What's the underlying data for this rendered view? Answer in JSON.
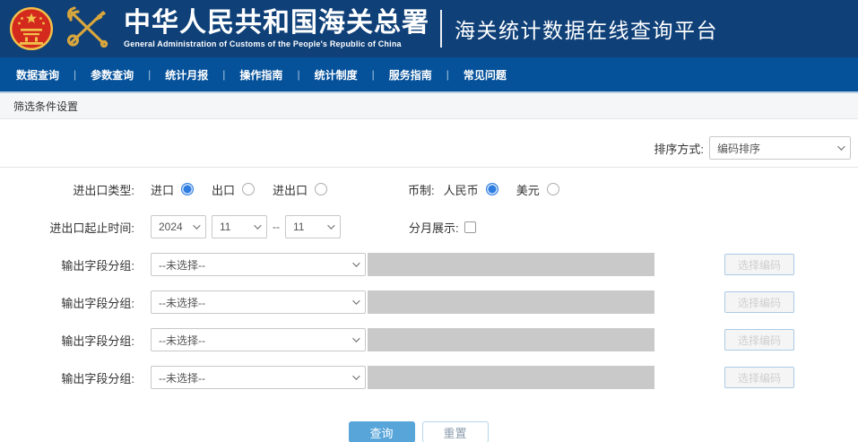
{
  "colors": {
    "header_bg": "#0f4078",
    "nav_bg": "#05529b",
    "query_button": "#58a5da",
    "radio_selected": "#2f7ce0",
    "disabled_input": "#c9c9c9"
  },
  "header": {
    "emblem_icon": "china-national-emblem",
    "key_icon": "customs-key-and-caduceus",
    "org_title": "中华人民共和国海关总署",
    "org_subtitle": "General Administration of Customs of the People's Republic of China",
    "platform_title": "海关统计数据在线查询平台"
  },
  "nav": {
    "separator": "|",
    "items": [
      {
        "label": "数据查询"
      },
      {
        "label": "参数查询"
      },
      {
        "label": "统计月报"
      },
      {
        "label": "操作指南"
      },
      {
        "label": "统计制度"
      },
      {
        "label": "服务指南"
      },
      {
        "label": "常见问题"
      }
    ]
  },
  "breadcrumb": {
    "title": "筛选条件设置"
  },
  "sort": {
    "label": "排序方式:",
    "value": "编码排序"
  },
  "form": {
    "trade_type": {
      "label": "进出口类型:",
      "options": [
        {
          "label": "进口",
          "checked": true
        },
        {
          "label": "出口",
          "checked": false
        },
        {
          "label": "进出口",
          "checked": false
        }
      ]
    },
    "currency": {
      "label": "币制:",
      "options": [
        {
          "label": "人民币",
          "checked": true
        },
        {
          "label": "美元",
          "checked": false
        }
      ]
    },
    "date_range": {
      "label": "进出口起止时间:",
      "start_year": "2024",
      "start_month": "11",
      "separator": "--",
      "end_month": "11"
    },
    "monthly_display": {
      "label": "分月展示:",
      "checked": false
    },
    "output_groups": [
      {
        "label": "输出字段分组:",
        "value": "--未选择--",
        "button": "选择编码"
      },
      {
        "label": "输出字段分组:",
        "value": "--未选择--",
        "button": "选择编码"
      },
      {
        "label": "输出字段分组:",
        "value": "--未选择--",
        "button": "选择编码"
      },
      {
        "label": "输出字段分组:",
        "value": "--未选择--",
        "button": "选择编码"
      }
    ],
    "actions": {
      "query": "查询",
      "reset": "重置"
    }
  }
}
